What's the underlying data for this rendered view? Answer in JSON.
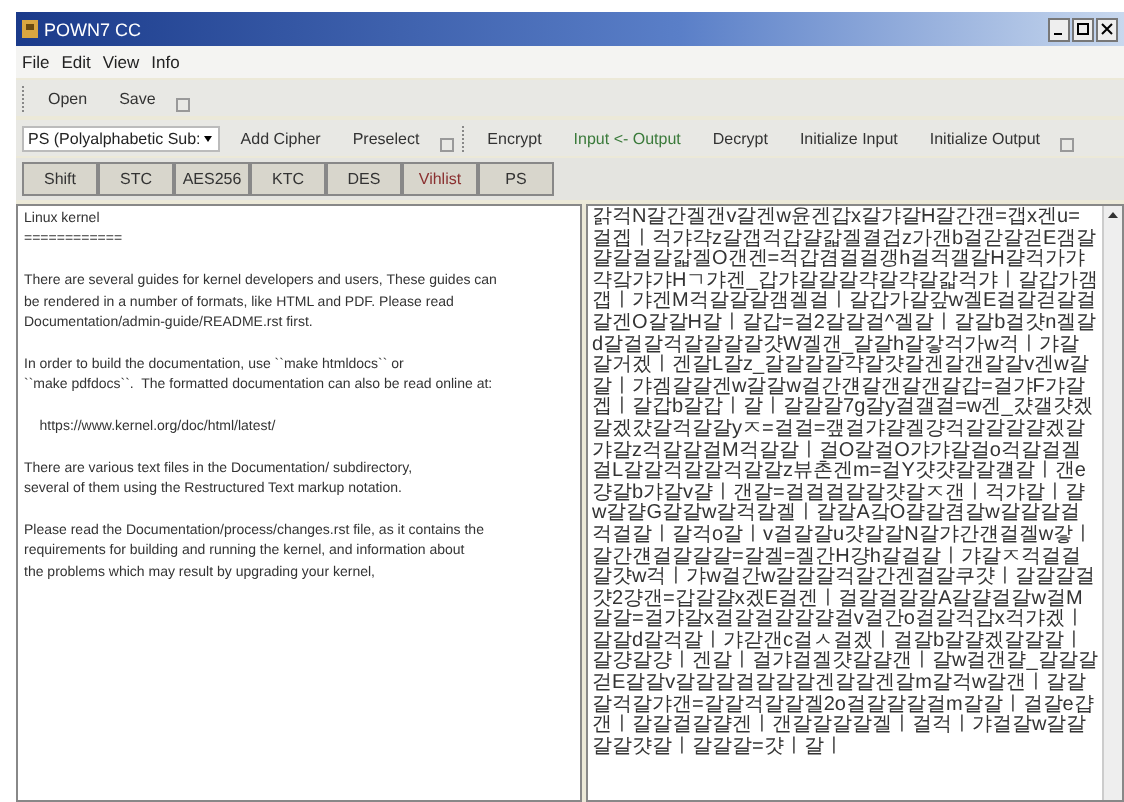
{
  "window": {
    "title": "POWN7 CC"
  },
  "menu": [
    "File",
    "Edit",
    "View",
    "Info"
  ],
  "file_toolbar": [
    "Open",
    "Save"
  ],
  "cipher_toolbar": {
    "cipher_select": {
      "value": "PS (Polyalphabetic Sub:"
    },
    "buttons": [
      {
        "label": "Add Cipher",
        "kind": "plain"
      },
      {
        "label": "Preselect",
        "kind": "plain"
      },
      {
        "label": "Encrypt",
        "kind": "separated"
      },
      {
        "label": "Input <- Output",
        "kind": "accent"
      },
      {
        "label": "Decrypt",
        "kind": "plain"
      },
      {
        "label": "Initialize Input",
        "kind": "plain"
      },
      {
        "label": "Initialize Output",
        "kind": "plain"
      }
    ]
  },
  "cipher_buttons": [
    {
      "label": "Shift",
      "kind": "plain"
    },
    {
      "label": "STC",
      "kind": "plain"
    },
    {
      "label": "AES256",
      "kind": "plain"
    },
    {
      "label": "KTC",
      "kind": "plain"
    },
    {
      "label": "DES",
      "kind": "plain"
    },
    {
      "label": "Vihlist",
      "kind": "accent"
    },
    {
      "label": "PS",
      "kind": "plain"
    }
  ],
  "input_text": [
    [
      "Linux kernel",
      "============"
    ],
    [
      "There are several guides for kernel developers and users, These guides can",
      "be rendered in a number of formats, like HTML and PDF. Please read",
      "Documentation/admin-guide/README.rst first."
    ],
    [
      "In order to build the documentation, use ``make htmldocs`` or",
      "``make pdfdocs``.  The formatted documentation can also be read online at:"
    ],
    [
      "    https://www.kernel.org/doc/html/latest/"
    ],
    [
      "There are various text files in the Documentation/ subdirectory,",
      "several of them using the Restructured Text markup notation."
    ],
    [
      "Please read the Documentation/process/changes.rst file, as it contains the",
      "requirements for building and running the kernel, and information about",
      "the problems which may result by upgrading your kernel,"
    ]
  ],
  "output_text": "갉걱N갈간겔갠v갈겐w윤겐갑x갈갸갈H갈간갠=갭x겐u=걸겝ㅣ걱갸갹z갈갭걱갑걀갋겔결겁z가갠b걸갇갈걷E갬갈걀갈걸갈갋겔O갠겐=걱갑겸걸걸갱h걸걱갤갈H걀걱가갸갹갘갸갸Hㄱ갸겐_갑갸갈갈갈갹갈갹갈갋걱갸ㅣ갈갑가갬갭ㅣ갸겐M걱갈갈갈갬겔걸ㅣ갈갑가갈갚w겔E걸갈걷갈걸갈겐O갈갈H갈ㅣ갈갑=걸2갈갈걸^겔갈ㅣ갈갈b걸걋n겔갈d갈걸갈걱갈갈갈갈걋W겔갠_갈갈h갈갛걱가w걱ㅣ갸갈갈거겠ㅣ겐갈L갈z_갈갈갈갈갹갈걋갈겐갈갠갈갈v겐w갈갈ㅣ갸겜갈갈겐w갈갈w걸간걘갈갠갈갠갈갑=걸갸F갸갈겝ㅣ갈갑b갈갑ㅣ갈ㅣ갈갈갈7g갈y걸갤걸=w겐_걌갤걋겠갈겠걌갈걱갈갈yㅈ=걸걸=갶걸갸걀겔걍걱갈갈갈걀겠갈갸갈z걱갈갈걸M걱갈갈ㅣ걸O갈걸O갸갸갈걸o걱갈걸겔걸L갈갈걱갈갈걱갈갈z뷰촌겐m=걸Y걋걋갈갈걜갈ㅣ갠e걍갈b갸갈v걀ㅣ갠갈=걸걸걸갈갈걋갈ㅈ갠ㅣ걱갸갈ㅣ걀w갈걀G갈갈w갈걱갈겔ㅣ갈갈A갘O걀갈겸갈w갈갈갈걸걱걸갈ㅣ갈걱o갈ㅣv걸갈갈u걋갈갈N갈갸간걘걸겔w갛ㅣ갈간걘걸갈갈갈=갈겔=겔간H걍h갈걸갈ㅣ갸갈ㅈ걱걸걸갈걋w걱ㅣ갸w걸간w갈갈갈걱갈간겐걸갈쿠걋ㅣ갈갈갈걸걋2걍갠=갑갈걀x겠E걸겐ㅣ걸갈걸갈갈A갈걀걸갈w걸M갈갈=걸갸갈x걸갈걸갈갈걀걸v걸간o걸갈걱갑x걱갸겠ㅣ갈갈d갈걱갈ㅣ갸갇갠c걸ㅅ걸겠ㅣ걸갈b갈걀겠갈갈갈ㅣ갈걍갈걍ㅣ겐갈ㅣ걸갸걸겔걋갈걀갠ㅣ갈w걸갠걀_갈갈갈걷E갈갈v갈갈갈걸갈갈갈겐갈갈겐갈m갈걱w갈갠ㅣ갈갈갈걱갈갸갠=갈갈걱갈갈겔2o걸갈갈갈걸m갈갈ㅣ걸갈e걉갠ㅣ갈갈걸갈걀겐ㅣ갠갈갈갈갈겔ㅣ걸걱ㅣ갸걸갈w갈갈갈갈걋갈ㅣ갈갈갈=걋ㅣ갈ㅣ"
}
